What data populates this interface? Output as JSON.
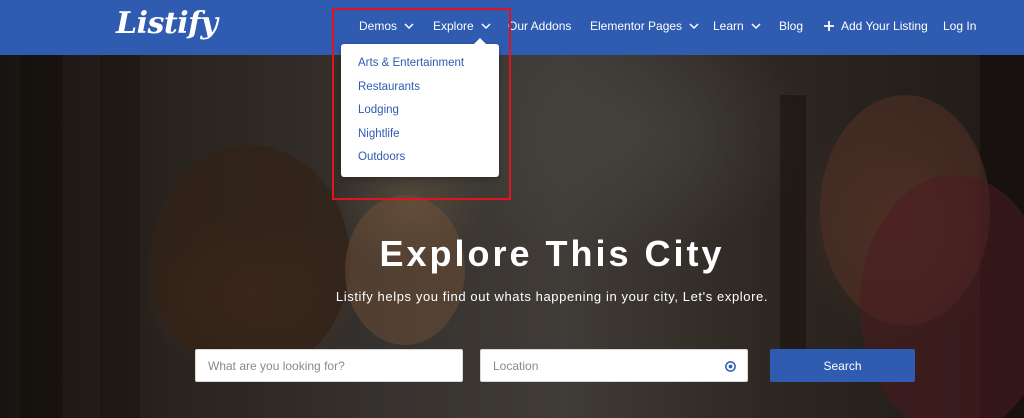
{
  "brand": {
    "logo_text": "Listify"
  },
  "nav": {
    "items": [
      {
        "label": "Demos",
        "has_chevron": true
      },
      {
        "label": "Explore",
        "has_chevron": true
      },
      {
        "label": "Our Addons",
        "has_chevron": false
      },
      {
        "label": "Elementor Pages",
        "has_chevron": true
      },
      {
        "label": "Learn",
        "has_chevron": true
      },
      {
        "label": "Blog",
        "has_chevron": false
      },
      {
        "label": "Add Your Listing",
        "icon": "plus-icon"
      },
      {
        "label": "Log In",
        "has_chevron": false
      }
    ]
  },
  "explore_menu": {
    "open": true,
    "items": [
      "Arts & Entertainment",
      "Restaurants",
      "Lodging",
      "Nightlife",
      "Outdoors"
    ]
  },
  "hero": {
    "title": "Explore This City",
    "subtitle": "Listify helps you find out whats happening in your city, Let's explore."
  },
  "search": {
    "keyword_placeholder": "What are you looking for?",
    "location_placeholder": "Location",
    "location_icon": "crosshair-icon",
    "button_label": "Search"
  },
  "colors": {
    "brand_blue": "#2f5bb1",
    "header_text": "#ffffff",
    "menu_link": "#2f5bb1",
    "highlight_border": "#e0141e"
  }
}
